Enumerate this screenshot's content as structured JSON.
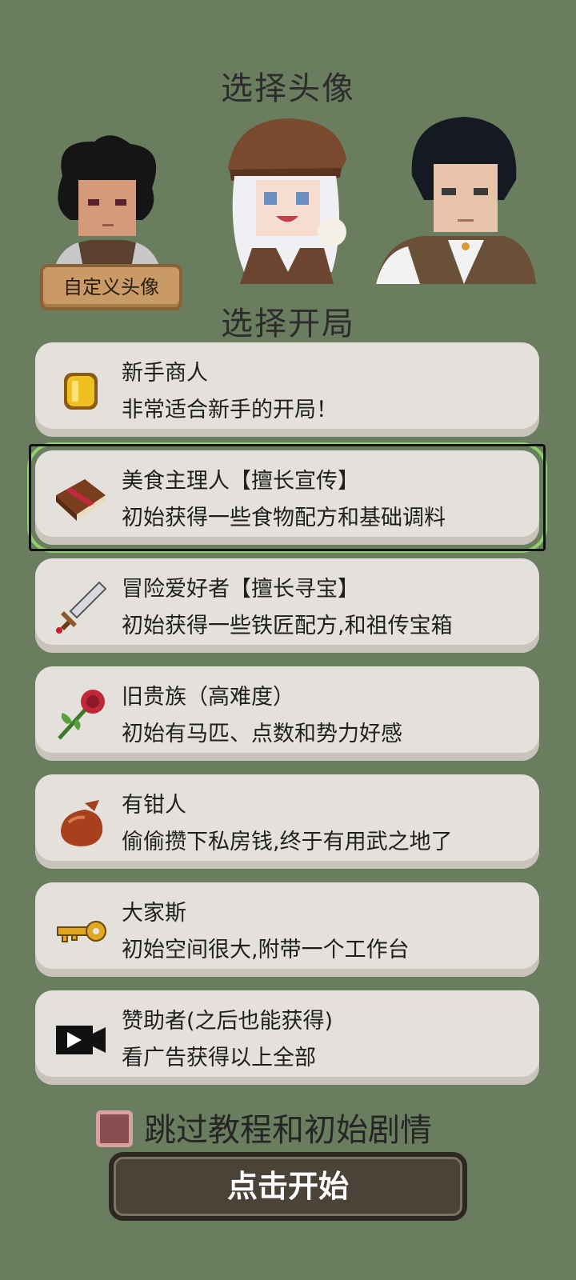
{
  "header": {
    "choose_avatar": "选择头像",
    "choose_start": "选择开局"
  },
  "avatars": {
    "custom_label": "自定义头像"
  },
  "options": [
    {
      "title": "新手商人",
      "desc": "非常适合新手的开局！",
      "icon": "gold-coin-icon"
    },
    {
      "title": "美食主理人【擅长宣传】",
      "desc": "初始获得一些食物配方和基础调料",
      "icon": "recipe-book-icon"
    },
    {
      "title": "冒险爱好者【擅长寻宝】",
      "desc": "初始获得一些铁匠配方,和祖传宝箱",
      "icon": "sword-icon"
    },
    {
      "title": "旧贵族（高难度）",
      "desc": "初始有马匹、点数和势力好感",
      "icon": "rose-icon"
    },
    {
      "title": "有钳人",
      "desc": "偷偷攒下私房钱,终于有用武之地了",
      "icon": "money-bag-icon"
    },
    {
      "title": "大家斯",
      "desc": "初始空间很大,附带一个工作台",
      "icon": "key-icon"
    },
    {
      "title": "赞助者(之后也能获得)",
      "desc": "看广告获得以上全部",
      "icon": "video-ad-icon"
    }
  ],
  "skip": {
    "label": "跳过教程和初始剧情",
    "checked": true
  },
  "start_button": "点击开始"
}
